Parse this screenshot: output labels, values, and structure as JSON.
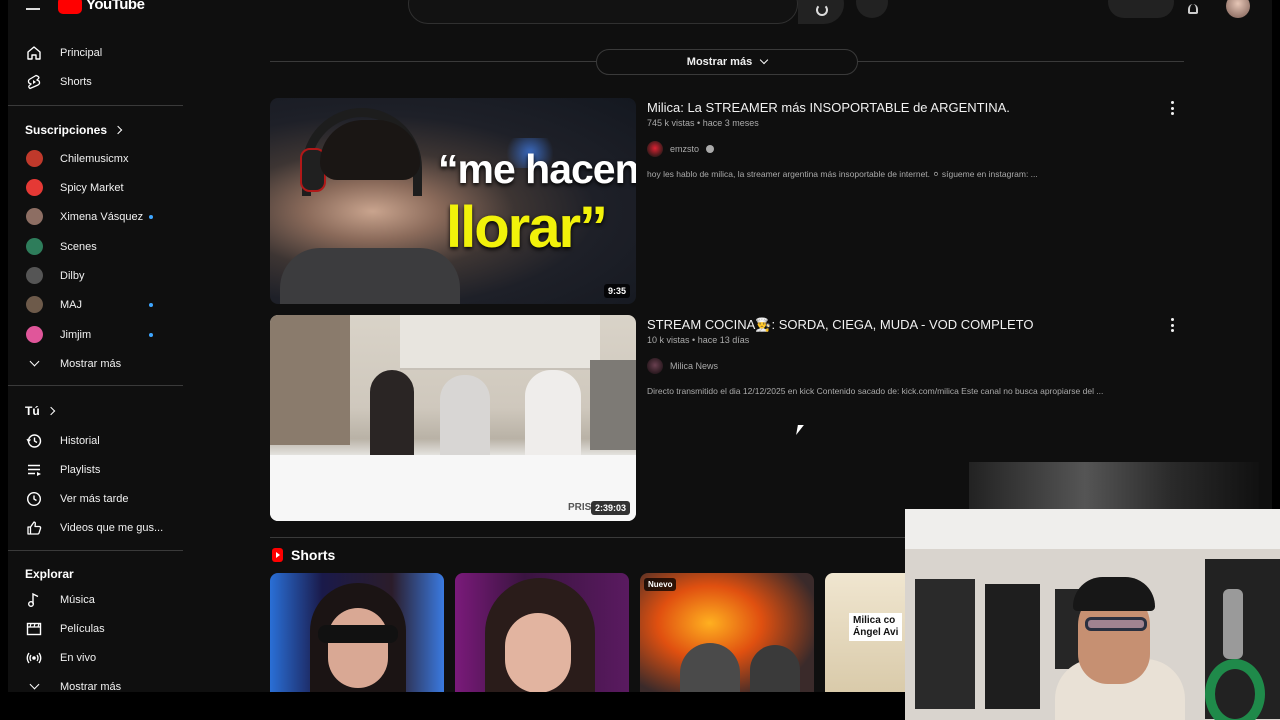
{
  "topbar": {
    "logo_text": "YouTube"
  },
  "sidebar": {
    "main_items": [
      {
        "label": "Principal",
        "icon": "home-icon"
      },
      {
        "label": "Shorts",
        "icon": "shorts-icon"
      }
    ],
    "subscriptions_heading": "Suscripciones",
    "subscriptions": [
      {
        "label": "Chilemusicmx",
        "color": "#c0392b",
        "new": false
      },
      {
        "label": "Spicy Market",
        "color": "#e53935",
        "new": false
      },
      {
        "label": "Ximena Vásquez",
        "color": "#8d6e63",
        "new": true
      },
      {
        "label": "Scenes",
        "color": "#2e7d5b",
        "new": false
      },
      {
        "label": "Dilby",
        "color": "#555555",
        "new": false
      },
      {
        "label": "MAJ",
        "color": "#6d5a4a",
        "new": true
      },
      {
        "label": "Jimjim",
        "color": "#e0569a",
        "new": true
      }
    ],
    "subscriptions_more": "Mostrar más",
    "you_heading": "Tú",
    "you_items": [
      {
        "label": "Historial",
        "icon": "history-icon"
      },
      {
        "label": "Playlists",
        "icon": "playlists-icon"
      },
      {
        "label": "Ver más tarde",
        "icon": "clock-icon"
      },
      {
        "label": "Videos que me gus...",
        "icon": "thumbs-up-icon"
      }
    ],
    "explore_heading": "Explorar",
    "explore_items": [
      {
        "label": "Música",
        "icon": "music-icon"
      },
      {
        "label": "Películas",
        "icon": "film-icon"
      },
      {
        "label": "En vivo",
        "icon": "live-icon"
      }
    ],
    "explore_more": "Mostrar más"
  },
  "main": {
    "show_more_label": "Mostrar más",
    "videos": [
      {
        "title": "Milica: La STREAMER más INSOPORTABLE de ARGENTINA.",
        "views": "745 k vistas",
        "age": "hace 3 meses",
        "channel": "emzsto",
        "verified": true,
        "description": "hoy les hablo de milica, la streamer argentina más insoportable de internet. ⚪ sígueme en instagram: ...",
        "duration": "9:35",
        "thumb_text_top": "“me hacen",
        "thumb_text_bottom": "llorar”"
      },
      {
        "title": "STREAM COCINA👨‍🍳: SORDA, CIEGA, MUDA - VOD COMPLETO",
        "views": "10 k vistas",
        "age": "hace 13 días",
        "channel": "Milica News",
        "verified": false,
        "description": "Directo transmitido el dia 12/12/2025 en kick Contenido sacado de: kick.com/milica Este canal no busca apropiarse del ...",
        "duration": "2:39:03",
        "thumb_watermark": "PRIS"
      }
    ],
    "shorts_heading": "Shorts",
    "shorts": [
      {
        "badge": "",
        "caption": ""
      },
      {
        "badge": "",
        "caption": ""
      },
      {
        "badge": "Nuevo",
        "caption": ""
      },
      {
        "badge": "",
        "caption": "Milica co\nÁngel Avi"
      }
    ]
  }
}
